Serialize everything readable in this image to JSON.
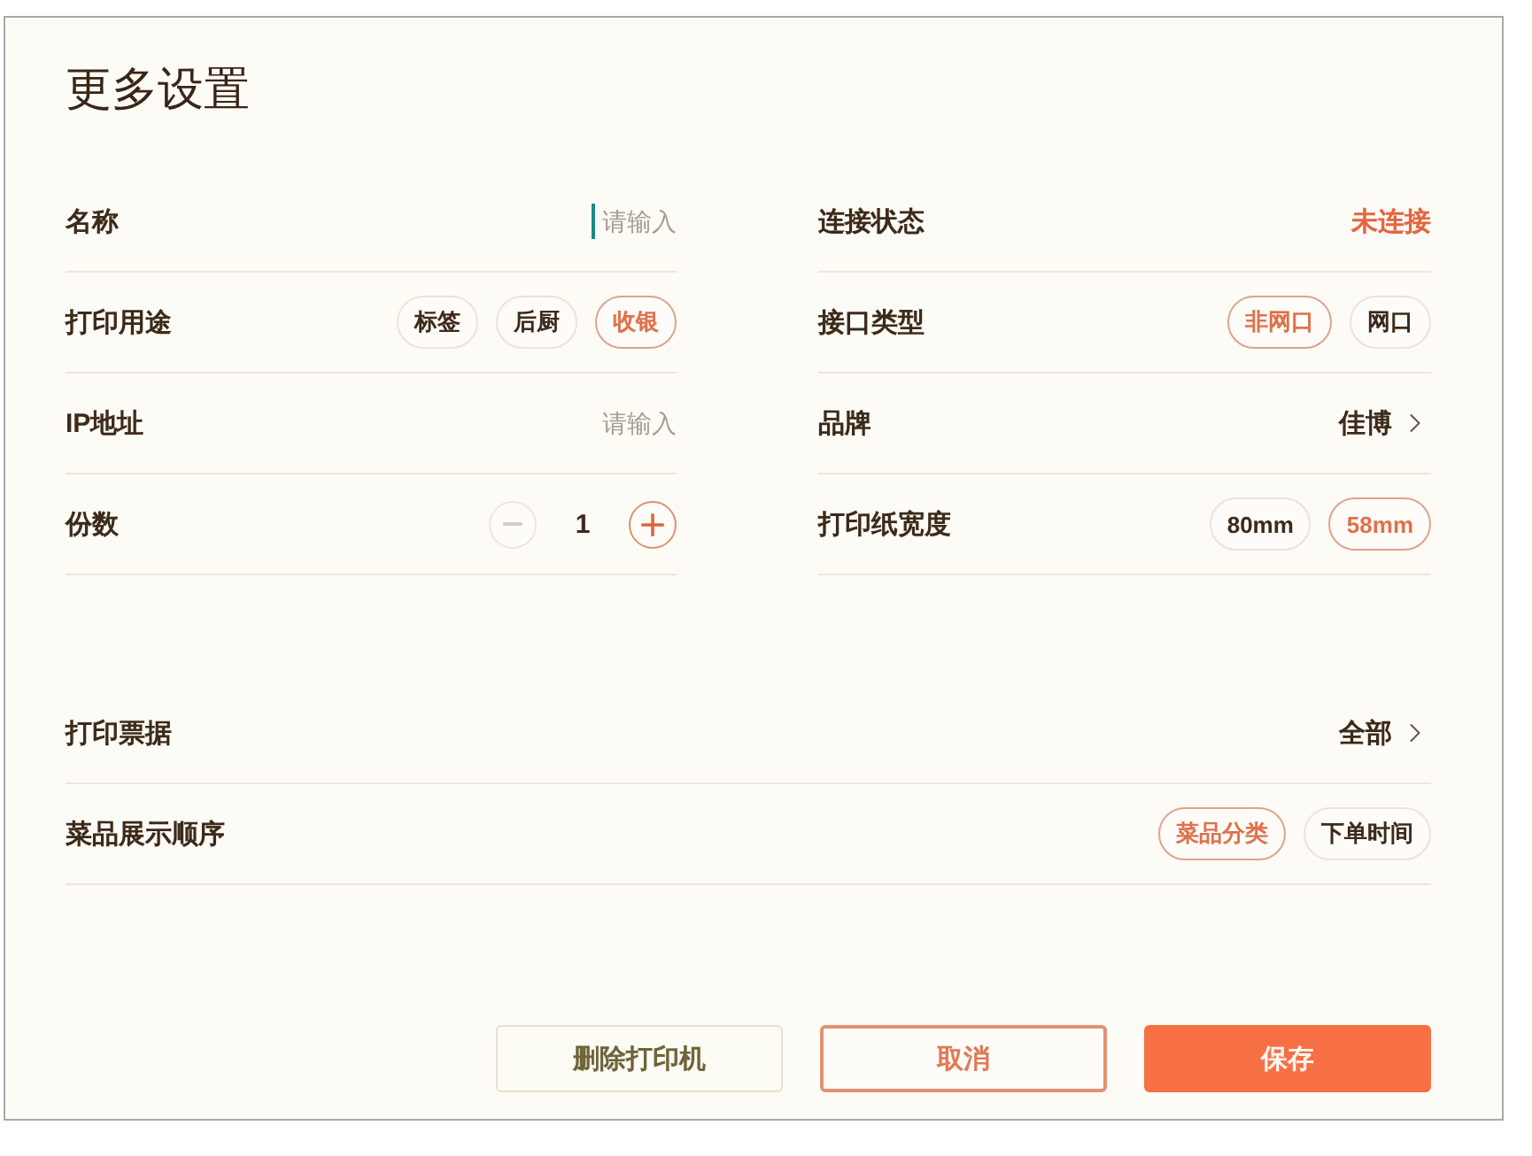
{
  "dialog": {
    "title": "更多设置"
  },
  "left_fields": [
    {
      "kind": "input",
      "label": "名称",
      "placeholder": "请输入",
      "focused": true
    },
    {
      "kind": "chips",
      "label": "打印用途",
      "options": [
        {
          "label": "标签",
          "selected": false
        },
        {
          "label": "后厨",
          "selected": false
        },
        {
          "label": "收银",
          "selected": true
        }
      ]
    },
    {
      "kind": "input",
      "label": "IP地址",
      "placeholder": "请输入",
      "focused": false
    },
    {
      "kind": "stepper",
      "label": "份数",
      "value": "1",
      "minus_disabled": true
    }
  ],
  "right_fields": [
    {
      "kind": "status",
      "label": "连接状态",
      "value": "未连接",
      "connected": false
    },
    {
      "kind": "chips",
      "label": "接口类型",
      "options": [
        {
          "label": "非网口",
          "selected": true
        },
        {
          "label": "网口",
          "selected": false
        }
      ]
    },
    {
      "kind": "link",
      "label": "品牌",
      "value": "佳博"
    },
    {
      "kind": "chips",
      "label": "打印纸宽度",
      "options": [
        {
          "label": "80mm",
          "selected": false
        },
        {
          "label": "58mm",
          "selected": true
        }
      ]
    }
  ],
  "wide_fields": [
    {
      "kind": "link",
      "label": "打印票据",
      "value": "全部"
    },
    {
      "kind": "chips",
      "label": "菜品展示顺序",
      "options": [
        {
          "label": "菜品分类",
          "selected": true
        },
        {
          "label": "下单时间",
          "selected": false
        }
      ]
    }
  ],
  "buttons": [
    {
      "kind": "plain",
      "label": "删除打印机"
    },
    {
      "kind": "outline",
      "label": "取消"
    },
    {
      "kind": "primary",
      "label": "保存"
    }
  ]
}
